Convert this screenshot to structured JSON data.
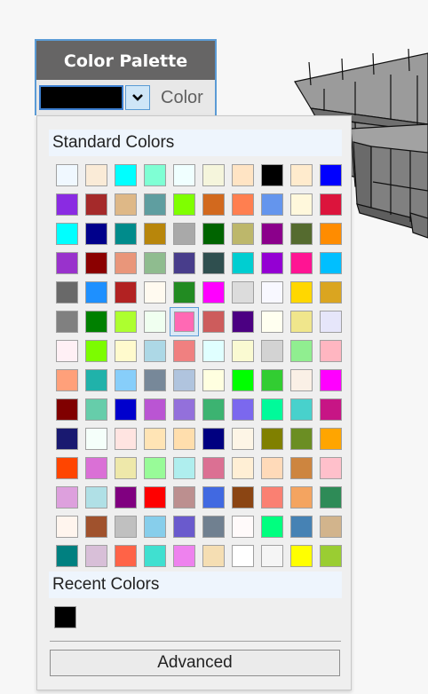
{
  "panel": {
    "title": "Color Palette",
    "current_color": "#000000",
    "label": "Color"
  },
  "popup": {
    "standard_title": "Standard Colors",
    "recent_title": "Recent Colors",
    "advanced_label": "Advanced",
    "selected_index": 54,
    "standard_colors": [
      "#f0f8ff",
      "#faebd7",
      "#00ffff",
      "#7fffd4",
      "#f0ffff",
      "#f5f5dc",
      "#ffe4c4",
      "#000000",
      "#ffebcd",
      "#0000ff",
      "#8a2be2",
      "#a52a2a",
      "#deb887",
      "#5f9ea0",
      "#7fff00",
      "#d2691e",
      "#ff7f50",
      "#6495ed",
      "#fff8dc",
      "#dc143c",
      "#00ffff",
      "#00008b",
      "#008b8b",
      "#b8860b",
      "#a9a9a9",
      "#006400",
      "#bdb76b",
      "#8b008b",
      "#556b2f",
      "#ff8c00",
      "#9932cc",
      "#8b0000",
      "#e9967a",
      "#8fbc8f",
      "#483d8b",
      "#2f4f4f",
      "#00ced1",
      "#9400d3",
      "#ff1493",
      "#00bfff",
      "#696969",
      "#1e90ff",
      "#b22222",
      "#fffaf0",
      "#228b22",
      "#ff00ff",
      "#dcdcdc",
      "#f8f8ff",
      "#ffd700",
      "#daa520",
      "#808080",
      "#008000",
      "#adff2f",
      "#f0fff0",
      "#ff69b4",
      "#cd5c5c",
      "#4b0082",
      "#fffff0",
      "#f0e68c",
      "#e6e6fa",
      "#fff0f5",
      "#7cfc00",
      "#fffacd",
      "#add8e6",
      "#f08080",
      "#e0ffff",
      "#fafad2",
      "#d3d3d3",
      "#90ee90",
      "#ffb6c1",
      "#ffa07a",
      "#20b2aa",
      "#87cefa",
      "#778899",
      "#b0c4de",
      "#ffffe0",
      "#00ff00",
      "#32cd32",
      "#faf0e6",
      "#ff00ff",
      "#800000",
      "#66cdaa",
      "#0000cd",
      "#ba55d3",
      "#9370db",
      "#3cb371",
      "#7b68ee",
      "#00fa9a",
      "#48d1cc",
      "#c71585",
      "#191970",
      "#f5fffa",
      "#ffe4e1",
      "#ffe4b5",
      "#ffdead",
      "#000080",
      "#fdf5e6",
      "#808000",
      "#6b8e23",
      "#ffa500",
      "#ff4500",
      "#da70d6",
      "#eee8aa",
      "#98fb98",
      "#afeeee",
      "#db7093",
      "#ffefd5",
      "#ffdab9",
      "#cd853f",
      "#ffc0cb",
      "#dda0dd",
      "#b0e0e6",
      "#800080",
      "#ff0000",
      "#bc8f8f",
      "#4169e1",
      "#8b4513",
      "#fa8072",
      "#f4a460",
      "#2e8b57",
      "#fff5ee",
      "#a0522d",
      "#c0c0c0",
      "#87ceeb",
      "#6a5acd",
      "#708090",
      "#fffafa",
      "#00ff7f",
      "#4682b4",
      "#d2b48c",
      "#008080",
      "#d8bfd8",
      "#ff6347",
      "#40e0d0",
      "#ee82ee",
      "#f5deb3",
      "#ffffff",
      "#f5f5f5",
      "#ffff00",
      "#9acd32"
    ],
    "recent_colors": [
      "#000000"
    ]
  }
}
